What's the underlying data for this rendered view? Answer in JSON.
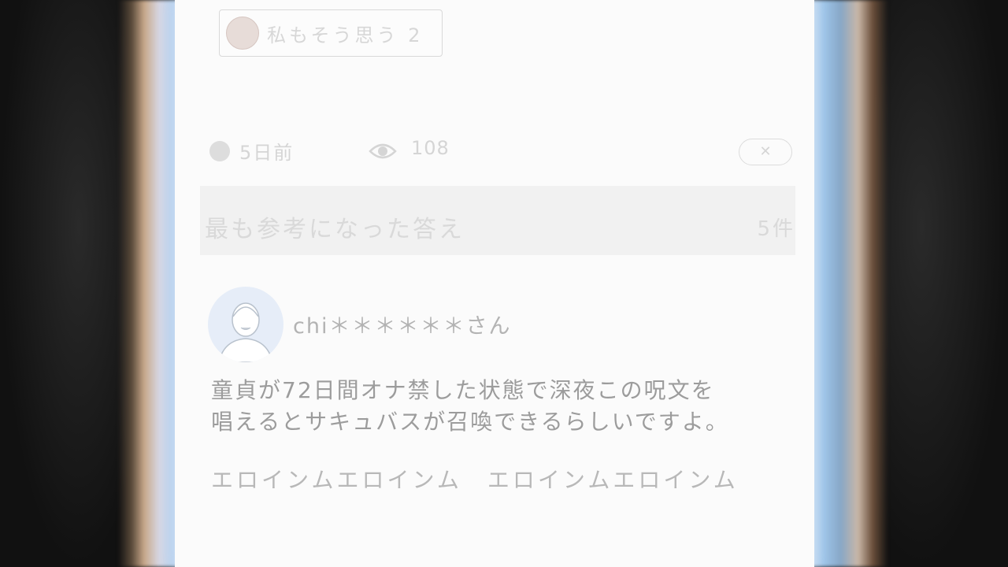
{
  "question": {
    "agree_label": "私もそう思う",
    "agree_count": "2",
    "posted_time": "5日前",
    "view_count": "108",
    "close_symbol": "✕"
  },
  "best_answers": {
    "title": "最も参考になった答え",
    "count": "5件"
  },
  "answer": {
    "username": "chi＊＊＊＊＊＊さん",
    "body_line1": "童貞が72日間オナ禁した状態で深夜この呪文を",
    "body_line2": "唱えるとサキュバスが召喚できるらしいですよ。",
    "spell": "エロインムエロインム　エロインムエロインム"
  },
  "icons": [
    "avatar-icon",
    "clock-dot-icon",
    "eye-icon",
    "close-icon",
    "user-avatar-icon"
  ]
}
